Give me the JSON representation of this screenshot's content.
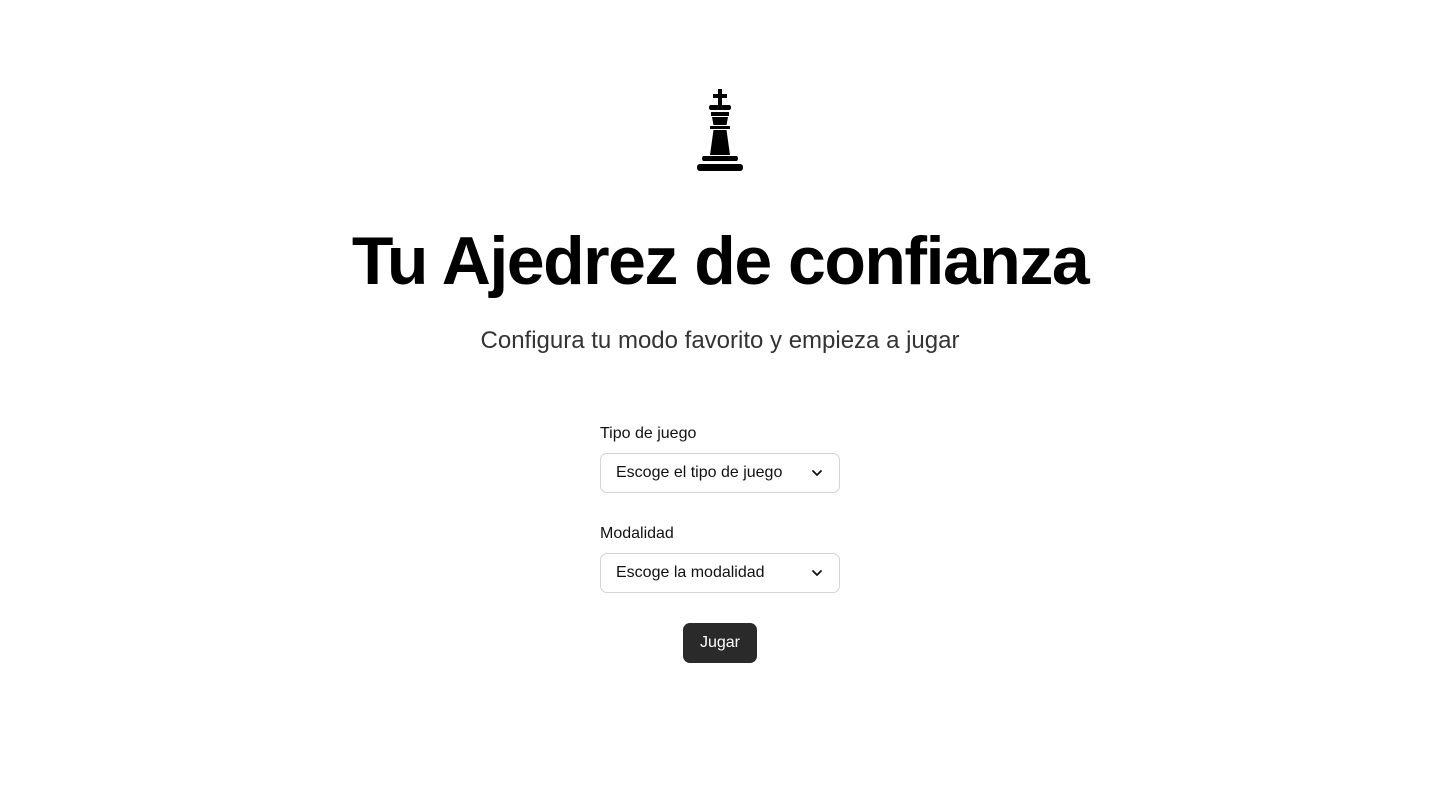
{
  "hero": {
    "logo_icon": "chess-king-icon",
    "title": "Tu Ajedrez de confianza",
    "subtitle": "Configura tu modo favorito y empieza a jugar"
  },
  "form": {
    "game_type": {
      "label": "Tipo de juego",
      "selected": "Escoge el tipo de juego",
      "icon": "chevron-down-icon"
    },
    "modality": {
      "label": "Modalidad",
      "selected": "Escoge la modalidad",
      "icon": "chevron-down-icon"
    },
    "submit_label": "Jugar"
  },
  "colors": {
    "background": "#ffffff",
    "text": "#000000",
    "button_bg": "#2a2a2a",
    "button_text": "#ffffff",
    "border": "#d4d4d8"
  }
}
